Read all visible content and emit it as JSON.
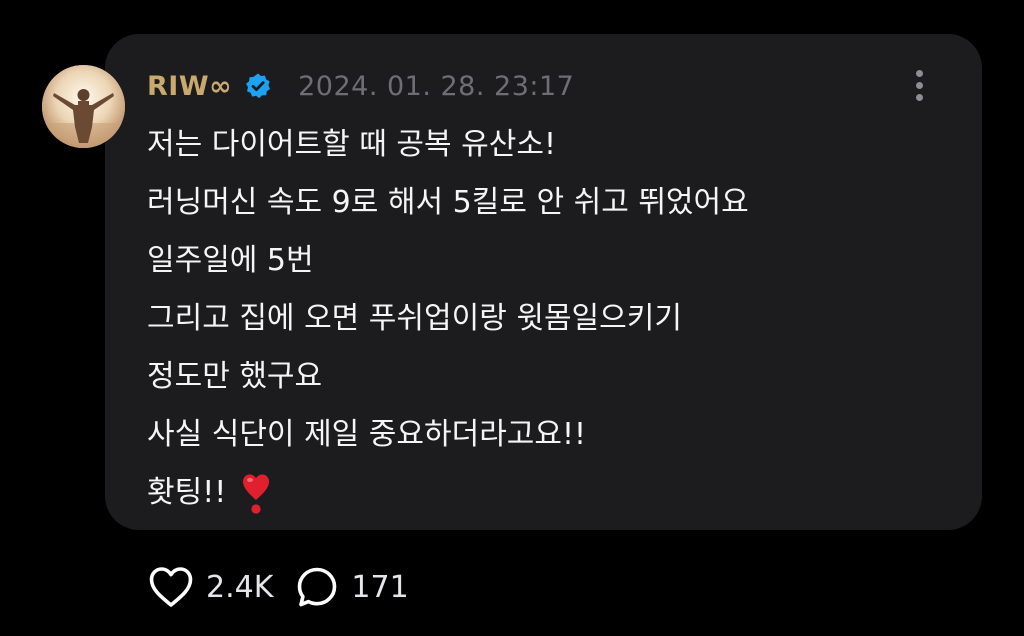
{
  "post": {
    "author": {
      "username": "RIW∞",
      "verified": true
    },
    "timestamp": "2024. 01. 28. 23:17",
    "lines": [
      "저는 다이어트할 때 공복 유산소!",
      "러닝머신 속도 9로 해서 5킬로 안 쉬고 뛰었어요",
      "일주일에 5번",
      "그리고 집에 오면 푸쉬업이랑 윗몸일으키기",
      "정도만 했구요",
      "사실 식단이 제일 중요하더라고요!!",
      "홧팅!!"
    ],
    "emoji": "heavy-heart-exclamation"
  },
  "actions": {
    "likes": "2.4K",
    "comments": "171"
  },
  "colors": {
    "background": "#000000",
    "card": "#1c1c1e",
    "username": "#c9a96e",
    "verified_badge": "#1da1f2",
    "timestamp": "#6e6e73",
    "text": "#f5f5f7",
    "heart_emoji": "#e0202f"
  },
  "icons": {
    "avatar": "avatar-person-arms-raised",
    "verified": "verified-badge-icon",
    "more": "more-vertical-icon",
    "like": "heart-outline-icon",
    "comment": "speech-bubble-icon"
  }
}
